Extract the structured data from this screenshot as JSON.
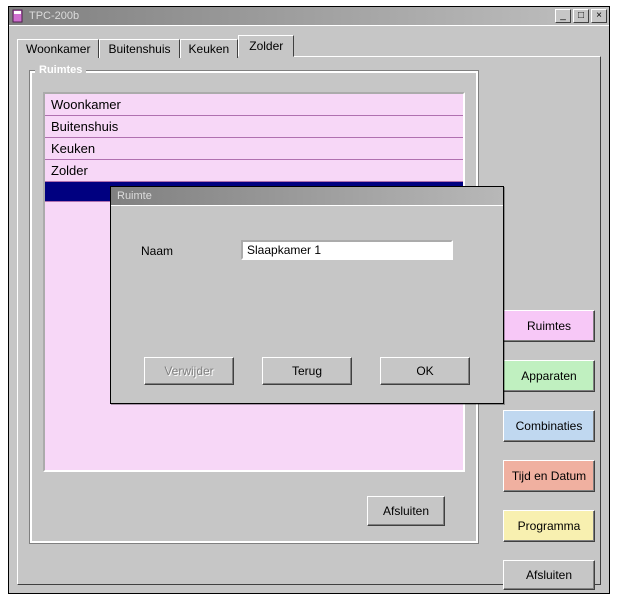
{
  "window": {
    "title": "TPC-200b",
    "controls": {
      "minimize": "_",
      "maximize": "□",
      "close": "×"
    }
  },
  "tabs": {
    "items": [
      "Woonkamer",
      "Buitenshuis",
      "Keuken",
      "Zolder"
    ],
    "active_index": 3
  },
  "group": {
    "label": "Ruimtes"
  },
  "list": {
    "rows": [
      "Woonkamer",
      "Buitenshuis",
      "Keuken",
      "Zolder"
    ],
    "selected_index": 4
  },
  "inner_close_label": "Afsluiten",
  "side": {
    "ruimtes": "Ruimtes",
    "apparaten": "Apparaten",
    "combinaties": "Combinaties",
    "tijd": "Tijd en Datum",
    "programma": "Programma",
    "afsluiten": "Afsluiten"
  },
  "dialog": {
    "title": "Ruimte",
    "field_label": "Naam",
    "field_value": "Slaapkamer 1",
    "buttons": {
      "delete": "Verwijder",
      "back": "Terug",
      "ok": "OK"
    }
  }
}
